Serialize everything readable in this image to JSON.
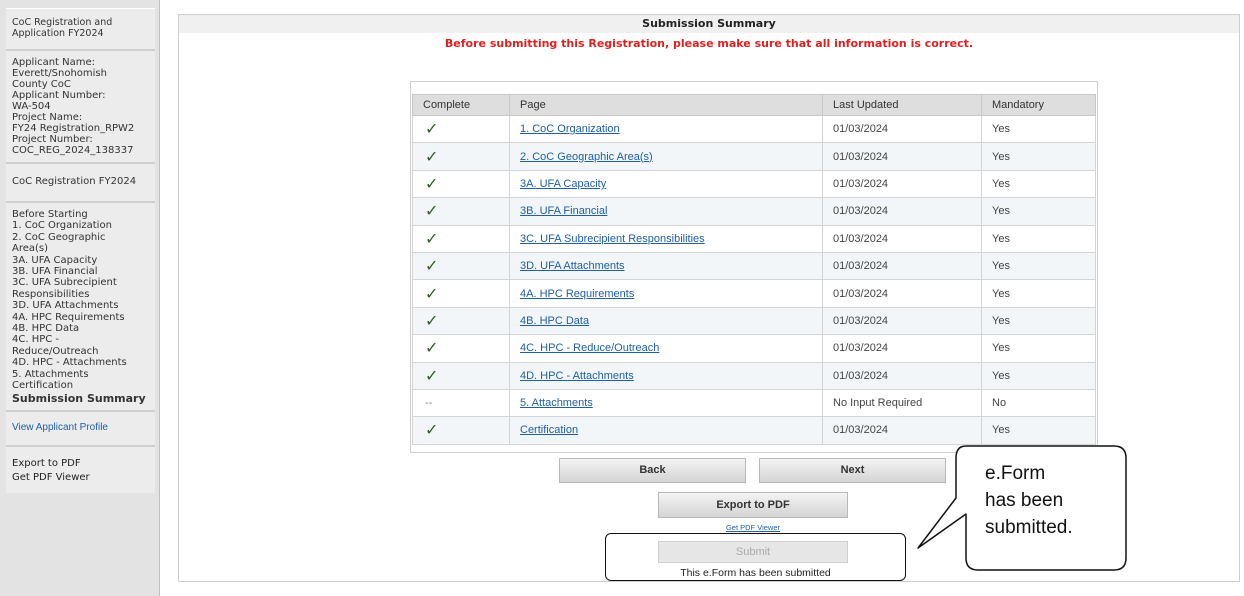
{
  "sidebar": {
    "title": [
      "CoC Registration and",
      "Application FY2024"
    ],
    "applicant_lines": [
      "Applicant Name:",
      "Everett/Snohomish",
      "County CoC",
      "Applicant Number:",
      "WA-504",
      "Project Name:",
      "FY24 Registration_RPW2",
      "Project Number:",
      "COC_REG_2024_138337"
    ],
    "registration_label": "CoC Registration FY2024",
    "nav": [
      "Before Starting",
      "1. CoC Organization",
      "2. CoC Geographic",
      "Area(s)",
      "3A. UFA Capacity",
      "3B. UFA Financial",
      "3C. UFA Subrecipient",
      "Responsibilities",
      "3D. UFA Attachments",
      "4A. HPC Requirements",
      "4B. HPC Data",
      "4C. HPC -",
      "Reduce/Outreach",
      "4D. HPC - Attachments",
      "5. Attachments",
      "Certification"
    ],
    "active_nav": "Submission Summary",
    "profile_link": "View Applicant Profile",
    "export_pdf": "Export to PDF",
    "get_pdf_viewer": "Get PDF Viewer"
  },
  "header": {
    "title": "Submission Summary",
    "warning": "Before submitting this Registration, please make sure that all information is correct."
  },
  "table": {
    "headers": [
      "Complete",
      "Page",
      "Last Updated",
      "Mandatory"
    ],
    "rows": [
      {
        "complete": "✓",
        "page": "1. CoC Organization",
        "updated": "01/03/2024",
        "mandatory": "Yes"
      },
      {
        "complete": "✓",
        "page": "2. CoC Geographic Area(s)",
        "updated": "01/03/2024",
        "mandatory": "Yes"
      },
      {
        "complete": "✓",
        "page": "3A. UFA Capacity",
        "updated": "01/03/2024",
        "mandatory": "Yes"
      },
      {
        "complete": "✓",
        "page": "3B. UFA Financial",
        "updated": "01/03/2024",
        "mandatory": "Yes"
      },
      {
        "complete": "✓",
        "page": "3C. UFA Subrecipient Responsibilities",
        "updated": "01/03/2024",
        "mandatory": "Yes"
      },
      {
        "complete": "✓",
        "page": "3D. UFA Attachments",
        "updated": "01/03/2024",
        "mandatory": "Yes"
      },
      {
        "complete": "✓",
        "page": "4A. HPC Requirements",
        "updated": "01/03/2024",
        "mandatory": "Yes"
      },
      {
        "complete": "✓",
        "page": "4B. HPC Data",
        "updated": "01/03/2024",
        "mandatory": "Yes"
      },
      {
        "complete": "✓",
        "page": "4C. HPC - Reduce/Outreach",
        "updated": "01/03/2024",
        "mandatory": "Yes"
      },
      {
        "complete": "✓",
        "page": "4D. HPC - Attachments",
        "updated": "01/03/2024",
        "mandatory": "Yes"
      },
      {
        "complete": "--",
        "page": "5. Attachments",
        "updated": "No Input Required",
        "mandatory": "No"
      },
      {
        "complete": "✓",
        "page": "Certification",
        "updated": "01/03/2024",
        "mandatory": "Yes"
      }
    ]
  },
  "buttons": {
    "back": "Back",
    "next": "Next",
    "export": "Export to PDF",
    "get_pdf": "Get PDF Viewer",
    "submit": "Submit"
  },
  "submitted_message": "This e.Form has been submitted",
  "callout_lines": [
    "e.Form",
    "has been",
    "submitted."
  ],
  "colors": {
    "warning": "#e02020",
    "check": "#2e5e23",
    "link": "#1f5fa8"
  },
  "icons": {
    "complete": "check-icon"
  }
}
